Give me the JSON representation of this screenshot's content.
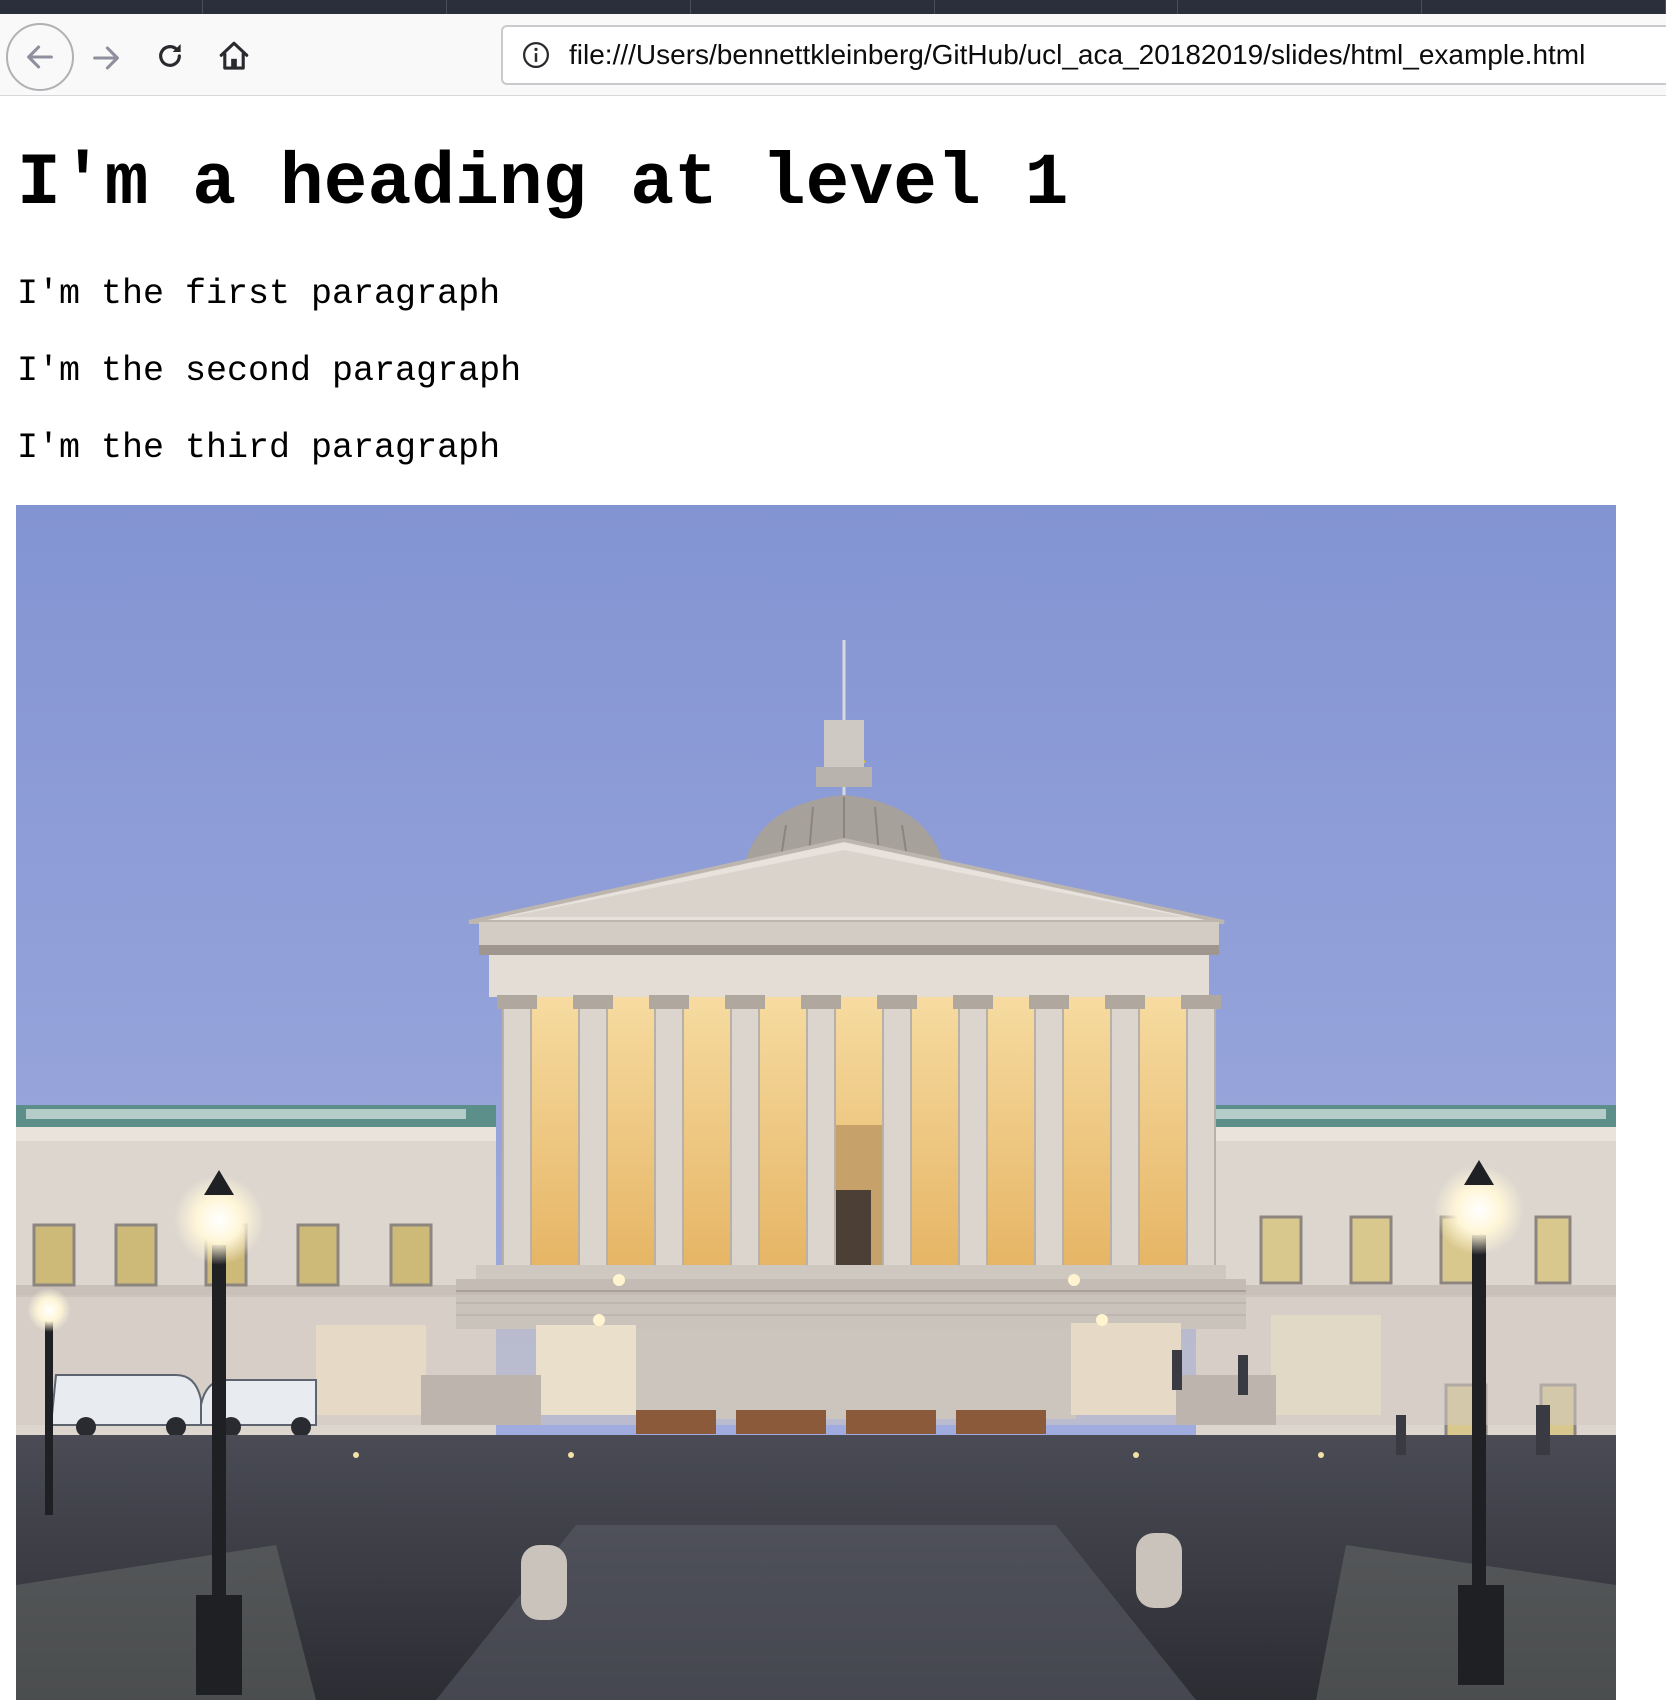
{
  "browser": {
    "tabs": [
      "",
      "",
      "",
      "",
      "",
      "",
      ""
    ],
    "toolbar": {
      "back_icon": "arrow-left-icon",
      "forward_icon": "arrow-right-icon",
      "reload_icon": "reload-icon",
      "home_icon": "home-icon"
    },
    "address_bar": {
      "icon": "info-icon",
      "url": "file:///Users/bennettkleinberg/GitHub/ucl_aca_20182019/slides/html_example.html"
    }
  },
  "page": {
    "heading": "I'm a heading at level 1",
    "paragraphs": [
      "I'm the first paragraph",
      "I'm the second paragraph",
      "I'm the third paragraph"
    ],
    "image": {
      "subject": "neoclassical-portico-building-photo"
    }
  },
  "colors": {
    "tab_strip": "#2b2e3b",
    "toolbar_bg": "#f9f9fa",
    "sky": "#8e9ed8",
    "stone": "#ddd6cf",
    "portico_light": "#f0cf86"
  }
}
